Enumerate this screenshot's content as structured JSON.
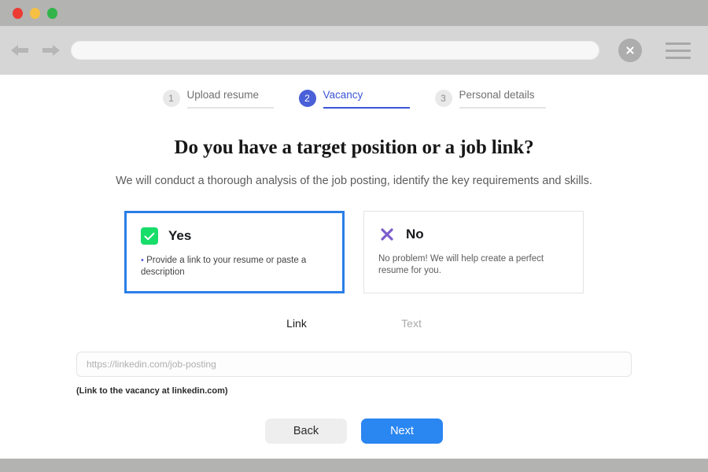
{
  "browser": {
    "traffic_lights": [
      "close",
      "minimize",
      "zoom"
    ],
    "back_icon": "arrow-left-icon",
    "forward_icon": "arrow-right-icon",
    "url_value": "",
    "url_placeholder": "",
    "close_icon": "close-x-icon",
    "menu_icon": "hamburger-menu-icon",
    "colors": {
      "titlebar": "#b3b3b1",
      "toolbar": "#d6d6d6",
      "red": "#ec3b32",
      "yellow": "#f5c044",
      "green": "#31b44a"
    }
  },
  "stepper": {
    "steps": [
      {
        "number": "1",
        "label": "Upload resume",
        "state": "inactive"
      },
      {
        "number": "2",
        "label": "Vacancy",
        "state": "active"
      },
      {
        "number": "3",
        "label": "Personal details",
        "state": "inactive"
      }
    ],
    "active_color": "#3b55d4",
    "inactive_color": "#8d8d8d"
  },
  "main": {
    "title": "Do you have a target position or a job link?",
    "subtitle": "We will conduct a thorough analysis of the job posting, identify the key requirements and skills.",
    "options": [
      {
        "id": "yes",
        "icon": "checkbox-checked-icon",
        "icon_color": "#17dd6b",
        "label": "Yes",
        "description": "Provide a link to your resume or paste a description",
        "bullet": "•",
        "selected": true,
        "border_color": "#2a7ee8"
      },
      {
        "id": "no",
        "icon": "x-mark-icon",
        "icon_color": "#7b5ecb",
        "label": "No",
        "description": "No problem! We will help create a perfect resume for you.",
        "bullet": "",
        "selected": false,
        "border_color": "#e3e3e3"
      }
    ],
    "tabs": [
      {
        "label": "Link",
        "active": true
      },
      {
        "label": "Text",
        "active": false
      }
    ],
    "input": {
      "value": "",
      "placeholder": "https://linkedin.com/job-posting"
    },
    "helper_text": "(Link to the vacancy at linkedin.com)",
    "buttons": {
      "back_label": "Back",
      "next_label": "Next",
      "next_color": "#2a86f0",
      "back_color": "#eeeeee"
    }
  }
}
